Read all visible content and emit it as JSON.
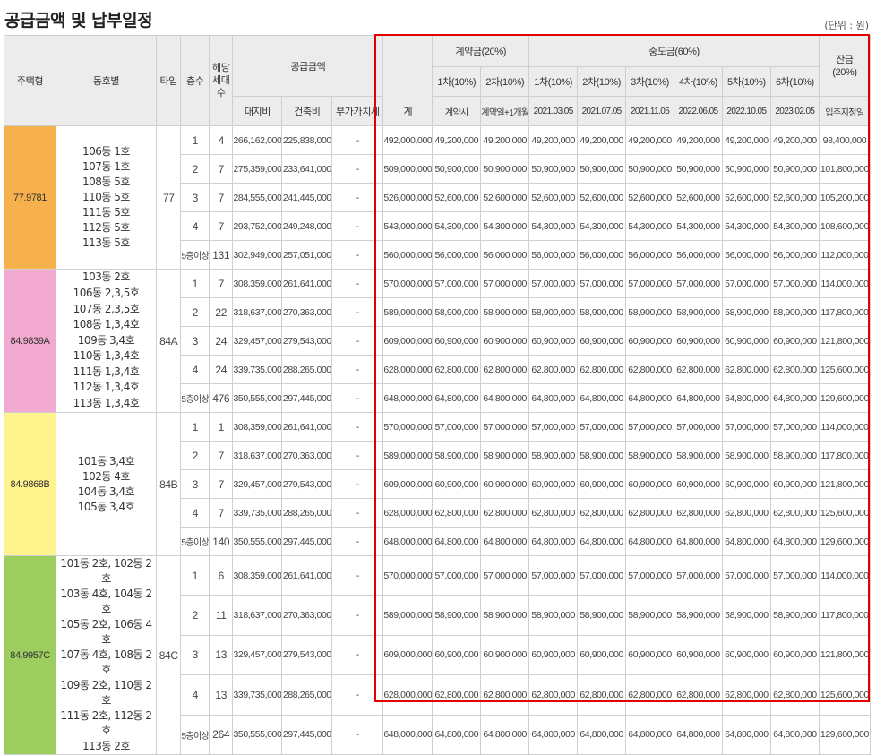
{
  "title": "공급금액 및 납부일정",
  "unit": "(단위 : 원)",
  "headers": {
    "house_type": "주택형",
    "unit": "동호별",
    "type": "타입",
    "floor": "층수",
    "households": "해당\n세대\n수",
    "supply_amount": "공급금액",
    "land": "대지비",
    "building": "건축비",
    "vat": "부가가치세",
    "total": "계",
    "contract": "계약금(20%)",
    "contract1": "1차(10%)",
    "contract2": "2차(10%)",
    "contract1_when": "계약시",
    "contract2_when": "계약일+1개월",
    "middle": "중도금(60%)",
    "mid": [
      "1차(10%)",
      "2차(10%)",
      "3차(10%)",
      "4차(10%)",
      "5차(10%)",
      "6차(10%)"
    ],
    "mid_dates": [
      "2021.03.05",
      "2021.07.05",
      "2021.11.05",
      "2022.06.05",
      "2022.10.05",
      "2023.02.05"
    ],
    "balance": "잔금\n(20%)",
    "balance_when": "입주지정일"
  },
  "colors": {
    "g1": "#f6b04c",
    "g2": "#f1a9cf",
    "g3": "#fff38d",
    "g4": "#9ccd5f",
    "highlight": "#e00000"
  },
  "groups": [
    {
      "house_type": "77.9781",
      "color": "#f6b04c",
      "type": "77",
      "units": "106동 1호\n107동 1호\n108동 5호\n110동 5호\n111동 5호\n112동 5호\n113동 5호",
      "rows": [
        {
          "floor": "1",
          "hh": "4",
          "land": "266,162,000",
          "bldg": "225,838,000",
          "vat": "-",
          "total": "492,000,000",
          "c1": "49,200,000",
          "c2": "49,200,000",
          "m": "49,200,000",
          "bal": "98,400,000"
        },
        {
          "floor": "2",
          "hh": "7",
          "land": "275,359,000",
          "bldg": "233,641,000",
          "vat": "-",
          "total": "509,000,000",
          "c1": "50,900,000",
          "c2": "50,900,000",
          "m": "50,900,000",
          "bal": "101,800,000"
        },
        {
          "floor": "3",
          "hh": "7",
          "land": "284,555,000",
          "bldg": "241,445,000",
          "vat": "-",
          "total": "526,000,000",
          "c1": "52,600,000",
          "c2": "52,600,000",
          "m": "52,600,000",
          "bal": "105,200,000"
        },
        {
          "floor": "4",
          "hh": "7",
          "land": "293,752,000",
          "bldg": "249,248,000",
          "vat": "-",
          "total": "543,000,000",
          "c1": "54,300,000",
          "c2": "54,300,000",
          "m": "54,300,000",
          "bal": "108,600,000"
        },
        {
          "floor": "5층이상",
          "hh": "131",
          "land": "302,949,000",
          "bldg": "257,051,000",
          "vat": "-",
          "total": "560,000,000",
          "c1": "56,000,000",
          "c2": "56,000,000",
          "m": "56,000,000",
          "bal": "112,000,000"
        }
      ]
    },
    {
      "house_type": "84.9839A",
      "color": "#f1a9cf",
      "type": "84A",
      "units": "103동 2호\n106동 2,3,5호\n107동 2,3,5호\n108동 1,3,4호\n109동 3,4호\n110동 1,3,4호\n111동 1,3,4호\n112동 1,3,4호\n113동 1,3,4호",
      "rows": [
        {
          "floor": "1",
          "hh": "7",
          "land": "308,359,000",
          "bldg": "261,641,000",
          "vat": "-",
          "total": "570,000,000",
          "c1": "57,000,000",
          "c2": "57,000,000",
          "m": "57,000,000",
          "bal": "114,000,000"
        },
        {
          "floor": "2",
          "hh": "22",
          "land": "318,637,000",
          "bldg": "270,363,000",
          "vat": "-",
          "total": "589,000,000",
          "c1": "58,900,000",
          "c2": "58,900,000",
          "m": "58,900,000",
          "bal": "117,800,000"
        },
        {
          "floor": "3",
          "hh": "24",
          "land": "329,457,000",
          "bldg": "279,543,000",
          "vat": "-",
          "total": "609,000,000",
          "c1": "60,900,000",
          "c2": "60,900,000",
          "m": "60,900,000",
          "bal": "121,800,000"
        },
        {
          "floor": "4",
          "hh": "24",
          "land": "339,735,000",
          "bldg": "288,265,000",
          "vat": "-",
          "total": "628,000,000",
          "c1": "62,800,000",
          "c2": "62,800,000",
          "m": "62,800,000",
          "bal": "125,600,000"
        },
        {
          "floor": "5층이상",
          "hh": "476",
          "land": "350,555,000",
          "bldg": "297,445,000",
          "vat": "-",
          "total": "648,000,000",
          "c1": "64,800,000",
          "c2": "64,800,000",
          "m": "64,800,000",
          "bal": "129,600,000"
        }
      ]
    },
    {
      "house_type": "84.9868B",
      "color": "#fff38d",
      "type": "84B",
      "units": "101동 3,4호\n102동 4호\n104동 3,4호\n105동 3,4호",
      "rows": [
        {
          "floor": "1",
          "hh": "1",
          "land": "308,359,000",
          "bldg": "261,641,000",
          "vat": "-",
          "total": "570,000,000",
          "c1": "57,000,000",
          "c2": "57,000,000",
          "m": "57,000,000",
          "bal": "114,000,000"
        },
        {
          "floor": "2",
          "hh": "7",
          "land": "318,637,000",
          "bldg": "270,363,000",
          "vat": "-",
          "total": "589,000,000",
          "c1": "58,900,000",
          "c2": "58,900,000",
          "m": "58,900,000",
          "bal": "117,800,000"
        },
        {
          "floor": "3",
          "hh": "7",
          "land": "329,457,000",
          "bldg": "279,543,000",
          "vat": "-",
          "total": "609,000,000",
          "c1": "60,900,000",
          "c2": "60,900,000",
          "m": "60,900,000",
          "bal": "121,800,000"
        },
        {
          "floor": "4",
          "hh": "7",
          "land": "339,735,000",
          "bldg": "288,265,000",
          "vat": "-",
          "total": "628,000,000",
          "c1": "62,800,000",
          "c2": "62,800,000",
          "m": "62,800,000",
          "bal": "125,600,000"
        },
        {
          "floor": "5층이상",
          "hh": "140",
          "land": "350,555,000",
          "bldg": "297,445,000",
          "vat": "-",
          "total": "648,000,000",
          "c1": "64,800,000",
          "c2": "64,800,000",
          "m": "64,800,000",
          "bal": "129,600,000"
        }
      ]
    },
    {
      "house_type": "84.9957C",
      "color": "#9ccd5f",
      "type": "84C",
      "units": "101동 2호, 102동 2호\n103동 4호, 104동 2호\n105동 2호, 106동 4호\n107동 4호, 108동 2호\n109동 2호, 110동 2호\n111동 2호, 112동 2호\n113동 2호",
      "rows": [
        {
          "floor": "1",
          "hh": "6",
          "land": "308,359,000",
          "bldg": "261,641,000",
          "vat": "-",
          "total": "570,000,000",
          "c1": "57,000,000",
          "c2": "57,000,000",
          "m": "57,000,000",
          "bal": "114,000,000"
        },
        {
          "floor": "2",
          "hh": "11",
          "land": "318,637,000",
          "bldg": "270,363,000",
          "vat": "-",
          "total": "589,000,000",
          "c1": "58,900,000",
          "c2": "58,900,000",
          "m": "58,900,000",
          "bal": "117,800,000"
        },
        {
          "floor": "3",
          "hh": "13",
          "land": "329,457,000",
          "bldg": "279,543,000",
          "vat": "-",
          "total": "609,000,000",
          "c1": "60,900,000",
          "c2": "60,900,000",
          "m": "60,900,000",
          "bal": "121,800,000"
        },
        {
          "floor": "4",
          "hh": "13",
          "land": "339,735,000",
          "bldg": "288,265,000",
          "vat": "-",
          "total": "628,000,000",
          "c1": "62,800,000",
          "c2": "62,800,000",
          "m": "62,800,000",
          "bal": "125,600,000"
        },
        {
          "floor": "5층이상",
          "hh": "264",
          "land": "350,555,000",
          "bldg": "297,445,000",
          "vat": "-",
          "total": "648,000,000",
          "c1": "64,800,000",
          "c2": "64,800,000",
          "m": "64,800,000",
          "bal": "129,600,000"
        }
      ]
    }
  ]
}
